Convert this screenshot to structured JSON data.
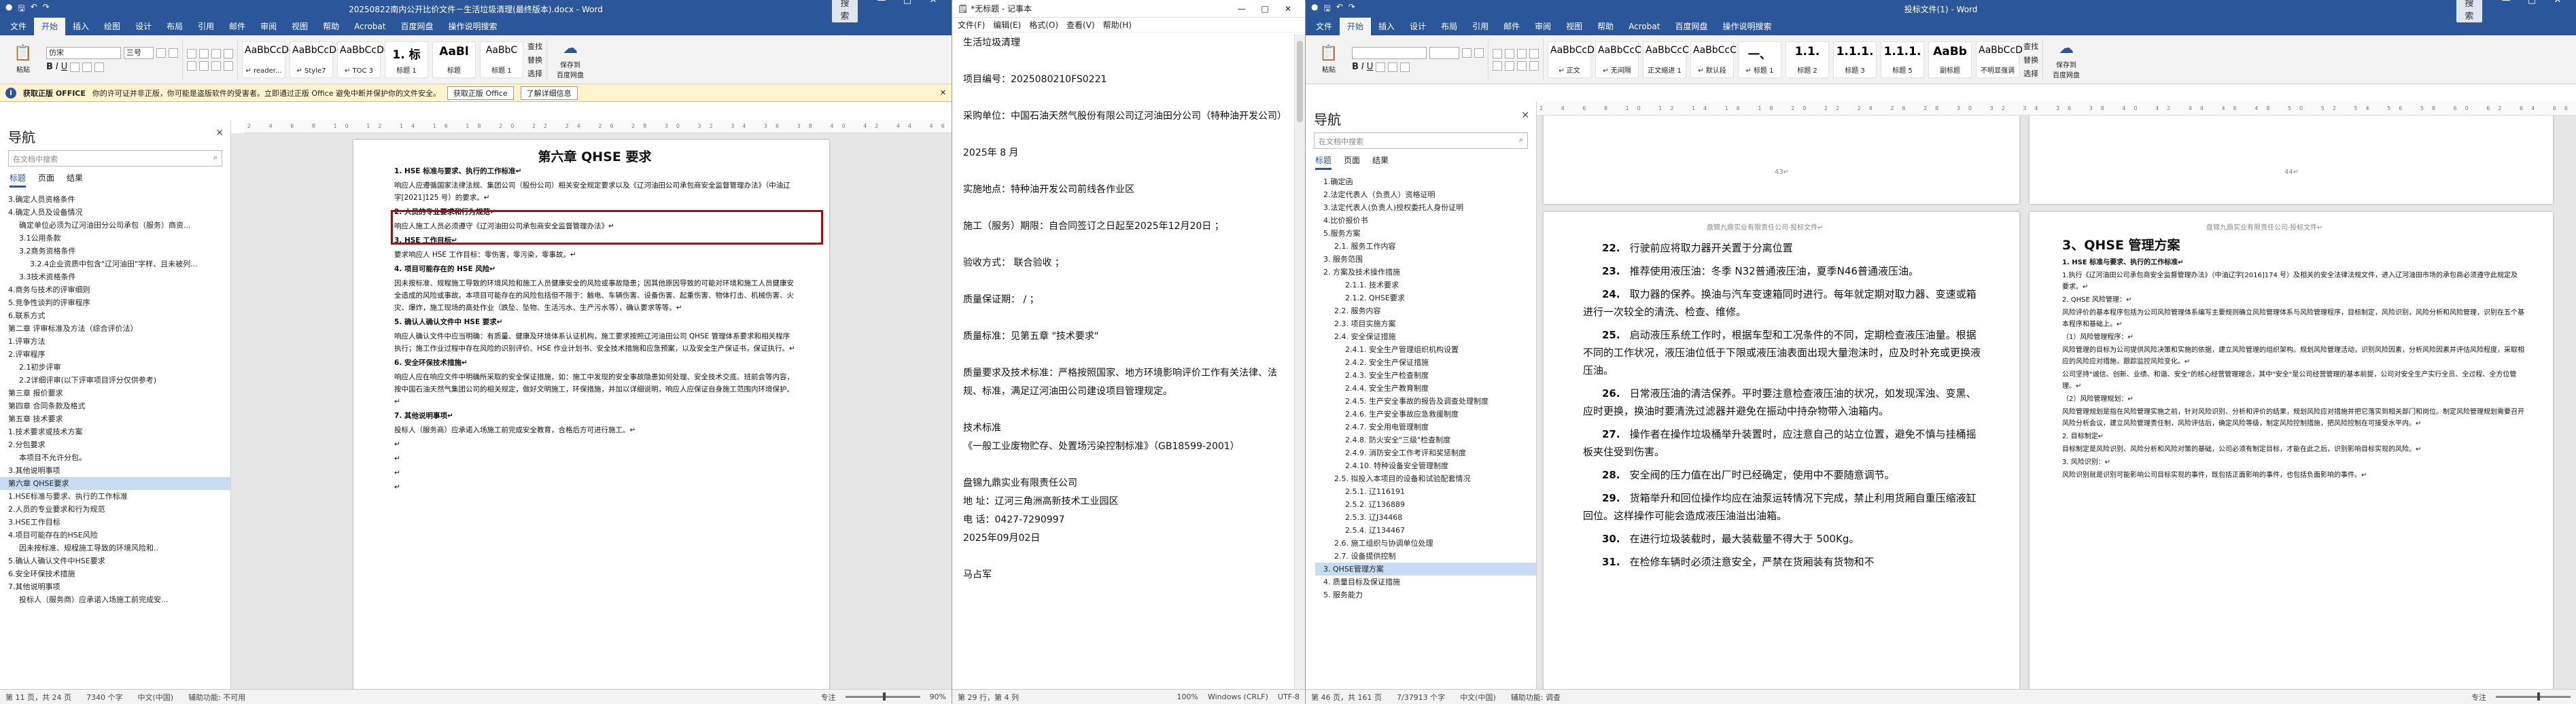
{
  "w1": {
    "title": "20250822南内公开比价文件－生活垃圾清理(最终版本).docx - Word",
    "search_btn": "搜索",
    "tabs": [
      "文件",
      "开始",
      "插入",
      "绘图",
      "设计",
      "布局",
      "引用",
      "邮件",
      "审阅",
      "视图",
      "帮助",
      "Acrobat",
      "百度网盘",
      "操作说明搜索"
    ],
    "font": "仿宋",
    "font_size": "三号",
    "paste": "粘贴",
    "styles": [
      {
        "s": "AaBbCcDd",
        "n": "↵ reader..."
      },
      {
        "s": "AaBbCcDd",
        "n": "↵ Style7"
      },
      {
        "s": "AaBbCcDd",
        "n": "↵ TOC 3"
      },
      {
        "s": "1. 标",
        "n": "标题 1"
      },
      {
        "s": "AaBl",
        "n": "标题"
      },
      {
        "s": "AaBbC",
        "n": "标题 1"
      }
    ],
    "find": "查找",
    "replace": "替换",
    "select": "选择",
    "save_baidu": "保存到\n百度网盘",
    "msg": {
      "bold": "获取正版 OFFICE",
      "text": "你的许可证并非正版，你可能是盗版软件的受害者。立即通过正版 Office 避免中断并保护你的文件安全。",
      "b1": "获取正版 Office",
      "b2": "了解详细信息"
    },
    "nav": {
      "title": "导航",
      "search": "在文档中搜索",
      "tabs": [
        "标题",
        "页面",
        "结果"
      ],
      "items": [
        "3.确定人员资格条件",
        "4.确定人员及设备情况",
        "确定单位必须为辽河油田分公司承包（服务）商资...",
        "3.1公用条款",
        "3.2商务资格条件",
        "3.2.4企业资质中包含\"辽河油田\"字样、且未被列...",
        "3.3技术资格条件",
        "4.商务与技术的评审细则",
        "5.竞争性谈判的评审程序",
        "6.联系方式",
        "第二章 评审标准及方法（综合评价法）",
        "1.评审方法",
        "2.评审程序",
        "2.1初步评审",
        "2.2详细评审(以下评审项目评分仅供参考)",
        "第三章 报价要求",
        "第四章 合同条款及格式",
        "第五章 技术要求",
        "1.技术要求或技术方案",
        "2.分包要求",
        "本项目不允许分包。",
        "3.其他说明事项",
        "第六章 QHSE要求",
        "",
        "1.HSE标准与要求、执行的工作标准",
        "2.人员的专业要求和行为规范",
        "3.HSE工作目标",
        "4.项目可能存在的HSE风险",
        "因未按标准、规程施工导致的环境风险和..",
        "5.确认人确认文件中HSE要求",
        "6.安全环保技术措施",
        "7.其他说明事项",
        "投标人（服务商）应承诺入场施工前完成安..."
      ],
      "hl": 22
    },
    "doc": {
      "heading": "第六章  QHSE 要求",
      "paras": [
        {
          "b": true,
          "t": "1. HSE 标准与要求、执行的工作标准↵"
        },
        {
          "t": "    响应人应遵循国家法律法规、集团公司（股份公司）相关安全规定要求以及《辽河油田公司承包商安全监督管理办法》（中油辽字[2021]125 号）的要求。↵",
          "box": true
        },
        {
          "b": true,
          "t": "2. 人员的专业要求和行为规范↵"
        },
        {
          "t": "    响应人施工人员必须遵守《辽河油田公司承包商安全监督管理办法》↵"
        },
        {
          "b": true,
          "t": "3. HSE 工作目标↵"
        },
        {
          "t": "    要求响应人 HSE 工作目标：零伤害，零污染，零事故。↵"
        },
        {
          "b": true,
          "t": "4. 项目可能存在的 HSE 风险↵"
        },
        {
          "t": "    因未按标准、规程施工导致的环境风险和施工人员健康安全的风险或事故隐患；因其他原因导致的可能对环境和施工人员健康安全造成的风险或事故。本项目可能存在的风险包括但不限于：触电、车辆伤害、设备伤害、起重伤害、物体打击、机械伤害、火灾、爆炸，施工现场的高处作业（跌坠、坠物、生活污水、生产污水等），确认要求等等。↵"
        },
        {
          "b": true,
          "t": "  5. 确认人确认文件中 HSE 要求↵"
        },
        {
          "t": "    响应人确认文件中应当明确：有质量、健康及环境体系认证机构，施工要求按照辽河油田公司 QHSE 管理体系要求和相关程序执行；施工作业过程中存在风险的识别评价、HSE 作业计划书、安全技术措施和应急预案，以及安全生产保证书，保证执行。↵"
        },
        {
          "b": true,
          "t": "6. 安全环保技术措施↵"
        },
        {
          "t": "    响应人应在响应文件中明确所采取的安全保证措施，如：施工中发现的安全事故隐患如何处理、安全技术交底、班前会等内容，按中国石油天然气集团公司的相关规定，做好文明施工，环保措施，并加以详细说明，响应人应保证自身施工范围内环境保护。↵"
        },
        {
          "b": true,
          "t": "  7. 其他说明事项↵"
        },
        {
          "t": "    投标人（服务商）应承诺入场施工前完成安全教育，合格后方可进行施工。↵"
        },
        {
          "t": "↵"
        },
        {
          "t": "↵"
        },
        {
          "t": "↵"
        },
        {
          "t": "↵"
        }
      ]
    },
    "status": {
      "page": "第 11 页，共 24 页",
      "words": "7340 个字",
      "lang": "中文(中国)",
      "acc": "辅助功能: 不可用",
      "focus": "专注",
      "zoom": "90%"
    }
  },
  "w2": {
    "title": "*无标题 - 记事本",
    "menu": [
      "文件(F)",
      "编辑(E)",
      "格式(O)",
      "查看(V)",
      "帮助(H)"
    ],
    "lines": [
      "生活垃圾清理",
      "",
      "项目编号：2025080210FS0221",
      "",
      "采购单位：中国石油天然气股份有限公司辽河油田分公司（特种油开发公司）",
      "",
      "2025年 8 月",
      "",
      "实施地点：特种油开发公司前线各作业区",
      "",
      "施工（服务）期限：自合同签订之日起至2025年12月20日   ；",
      "",
      "验收方式：  联合验收       ；",
      "",
      "质量保证期：  /   ；",
      "",
      "质量标准：见第五章 \"技术要求\"",
      "",
      "质量要求及技术标准：严格按照国家、地方环境影响评价工作有关法律、法规、标准，满足辽河油田公司建设项目管理规定。",
      "",
      "技术标准",
      "《一般工业废物贮存、处置场污染控制标准》（GB18599-2001）",
      "",
      "盘锦九鼎实业有限责任公司",
      "地  址：辽河三角洲高新技术工业园区",
      "电  话：0427-7290997",
      "2025年09月02日",
      "",
      "马占军"
    ],
    "status": {
      "pos": "第 29 行，第 4 列",
      "zoom": "100%",
      "eol": "Windows (CRLF)",
      "enc": "UTF-8"
    }
  },
  "w3": {
    "title": "投标文件(1) - Word",
    "search_btn": "搜索",
    "tabs": [
      "文件",
      "开始",
      "插入",
      "设计",
      "布局",
      "引用",
      "邮件",
      "审阅",
      "视图",
      "帮助",
      "Acrobat",
      "百度网盘",
      "操作说明搜索"
    ],
    "paste": "粘贴",
    "styles": [
      {
        "s": "AaBbCcD",
        "n": "↵ 正文"
      },
      {
        "s": "AaBbCcC",
        "n": "↵ 无间隔"
      },
      {
        "s": "AaBbCcC",
        "n": "正文缩进 1"
      },
      {
        "s": "AaBbCcC",
        "n": "↵ 默认段"
      },
      {
        "s": "一、",
        "n": "↵ 标题 1"
      },
      {
        "s": "1.1.",
        "n": "标题 2"
      },
      {
        "s": "1.1.1.",
        "n": "标题 3"
      },
      {
        "s": "1.1.1.",
        "n": "标题 5"
      },
      {
        "s": "AaBb",
        "n": "副标题"
      },
      {
        "s": "AaBbCcD",
        "n": "不明显强调"
      }
    ],
    "find": "查找",
    "replace": "替换",
    "select": "选择",
    "save_baidu": "保存到\n百度网盘",
    "nav": {
      "title": "导航",
      "search": "在文档中搜索",
      "tabs": [
        "标题",
        "页面",
        "结果"
      ],
      "items": [
        "1.确定函",
        "2.法定代表人（负责人）资格证明",
        "3.法定代表人(负责人)授权委托人身份证明",
        "4.比价报价书",
        "5.服务方案",
        "2.1. 服务工作内容",
        "3. 服务范围",
        "2. 方案及技术操作措施",
        "2.1.1. 技术要求",
        "2.1.2. QHSE要求",
        "2.2. 服务内容",
        "2.3. 项目实施方案",
        "2.4. 安全保证措施",
        "2.4.1. 安全生产管理组织机构设置",
        "2.4.2. 安全生产保证措施",
        "2.4.3. 安全生产检查制度",
        "2.4.4. 安全生产教育制度",
        "2.4.5. 生产安全事故的报告及调查处理制度",
        "2.4.6. 生产安全事故应急救援制度",
        "2.4.7. 安全用电管理制度",
        "2.4.8. 防火安全\"三级\"检查制度",
        "2.4.9. 消防安全工作考评和奖惩制度",
        "2.4.10. 特种设备安全管理制度",
        "2.5. 拟投入本项目的设备和试验配套情况",
        "2.5.1. 辽116191",
        "2.5.2. 辽136889",
        "2.5.3. 辽J34468",
        "2.5.4. 辽134467",
        "2.6. 施工组织与协调单位处理",
        "2.7. 设备提供控制",
        "3. QHSE管理方案",
        "4. 质量目标及保证措施",
        "5. 服务能力"
      ],
      "hl": 30
    },
    "pageA_num": "43↵",
    "pageB_num": "44↵",
    "hdr": "盘锦九鼎实业有限责任公司·投标文件↵",
    "pA": [
      {
        "n": "22.",
        "t": "行驶前应将取力器开关置于分离位置"
      },
      {
        "n": "23.",
        "t": "推荐使用液压油：冬季 N32普通液压油，夏季N46普通液压油。"
      },
      {
        "n": "24.",
        "t": "取力器的保养。换油与汽车变速箱同时进行。每年就定期对取力器、变速或箱进行一次较全的清洗、检查、维修。"
      },
      {
        "n": "25.",
        "t": "启动液压系统工作时，根据车型和工况条件的不同，定期检查液压油量。根据不同的工作状况，液压油位低于下限或液压油表面出现大量泡沫时，应及时补充或更换液压油。"
      },
      {
        "n": "26.",
        "t": "日常液压油的清洁保养。平时要注意检查液压油的状况，如发现浑浊、变黑、应时更换，换油时要清洗过滤器并避免在振动中持杂物带入油箱内。"
      },
      {
        "n": "27.",
        "t": "操作者在操作垃圾桶举升装置时，应注意自己的站立位置，避免不慎与挂桶摇板夹住受到伤害。"
      },
      {
        "n": "28.",
        "t": "安全阀的压力值在出厂时已经确定，使用中不要随意调节。"
      },
      {
        "n": "29.",
        "t": "货箱举升和回位操作均应在油泵运转情况下完成，禁止利用货厢自重压缩液缸回位。这样操作可能会造成液压油溢出油箱。"
      },
      {
        "n": "30.",
        "t": "在进行垃圾装载时，最大装载量不得大于 500Kg。"
      },
      {
        "n": "31.",
        "t": "在检修车辆时必须注意安全，严禁在货厢装有货物和不"
      }
    ],
    "pB_heading": "3、QHSE 管理方案",
    "pB": [
      {
        "b": true,
        "t": "1. HSE 标准与要求、执行的工作标准↵"
      },
      {
        "t": "    1.执行《辽河油田公司承包商安全监督管理办法》（中油辽字[2016]174 号）及相关的安全法律法规文件，进入辽河油田市场的承包商必须遵守此规定及要求。↵",
        "box": true
      },
      {
        "t": "    2. QHSE 风险管理：↵"
      },
      {
        "t": "    风险评价的基本程序包括为公司风险管理体系编写主要规则确立风险管理体系与风险管理程序，目标制定，风险识别，风险分析和风险管理，识别在五个基本程序和基础上。↵"
      },
      {
        "t": "    （1）风险管理程序：↵"
      },
      {
        "t": "    风险管理的目标为公司提供风险决策和实施的依据，建立风险管理的组织架构。规划风险管理活动，识别风险因素，分析风险因素并评估风险程度，采取相应的风险应对措施，跟踪监控风险变化。↵"
      },
      {
        "t": "    公司坚持\"诚信、创新、业绩、和谐、安全\"的核心经营管理理念，其中\"安全\"是公司经营管理的基本前提，公司对安全生产实行全员、全过程、全方位管理。↵"
      },
      {
        "t": "    （2）风险管理规划：↵"
      },
      {
        "t": "    风险管理规划是指在风险管理实施之前，针对风险识别、分析和评价的结果，规划风险应对措施并把它落实到相关部门和岗位。制定风险管理规划需要召开风险分析会议，建立风险管理责任制，风险评估后，确定风险等级，制定风险控制措施，把风险控制在可接受水平内。↵"
      },
      {
        "t": "    2. 目标制定↵"
      },
      {
        "t": "    目标制定是风险识别、风险分析和风险对策的基础，公司必须有制定目标，才能在此之后，识别影响目标实现的风险。↵"
      },
      {
        "t": "    3. 风险识别：↵"
      },
      {
        "t": "    风险识别就是识别可能影响公司目标实现的事件，既包括正面影响的事件，也包括负面影响的事件。↵"
      }
    ],
    "status": {
      "page": "第 46 页，共 161 页",
      "words": "7/37913 个字",
      "lang": "中文(中国)",
      "acc": "辅助功能: 调查",
      "focus": "专注"
    }
  }
}
